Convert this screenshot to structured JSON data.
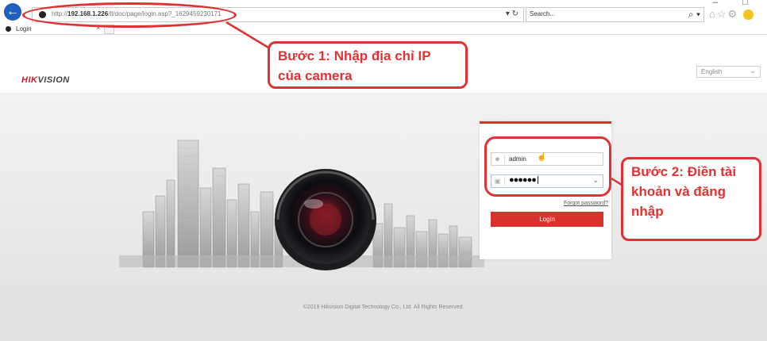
{
  "browser": {
    "url_prefix": "http://",
    "url_host": "192.168.1.226",
    "url_rest": "/lt/doc/page/login.asp?_1629459230171",
    "search_placeholder": "Search...",
    "address_tools": "▾ ↻",
    "search_icon": "⌕ ▾",
    "window_controls": "– □ ×",
    "nav_icons": "⌂☆⚙",
    "tab_label": "Login",
    "tab_close": "×"
  },
  "page": {
    "logo_red": "HIK",
    "logo_dark": "VISION",
    "language": "English",
    "copyright": "©2019 Hikvision Digital Technology Co., Ltd. All Rights Reserved."
  },
  "login": {
    "username": "admin",
    "password_mask": "●●●●●●",
    "forgot": "Forgot password?",
    "button": "Login"
  },
  "annotations": {
    "step1": "Bước 1: Nhập địa chỉ IP của camera",
    "step2": "Bước 2: Điền tài khoản và đăng nhập"
  },
  "colors": {
    "accent": "#d9322e",
    "annotation": "#e03232",
    "back_button": "#1e5fbf"
  },
  "icons": [
    "back-arrow-icon",
    "globe-favicon-icon",
    "dropdown-icon",
    "refresh-icon",
    "search-icon",
    "home-icon",
    "star-icon",
    "gear-icon",
    "smiley-icon",
    "close-icon",
    "user-icon",
    "lock-icon",
    "eye-toggle-icon",
    "cursor-icon",
    "chevron-down-icon"
  ]
}
